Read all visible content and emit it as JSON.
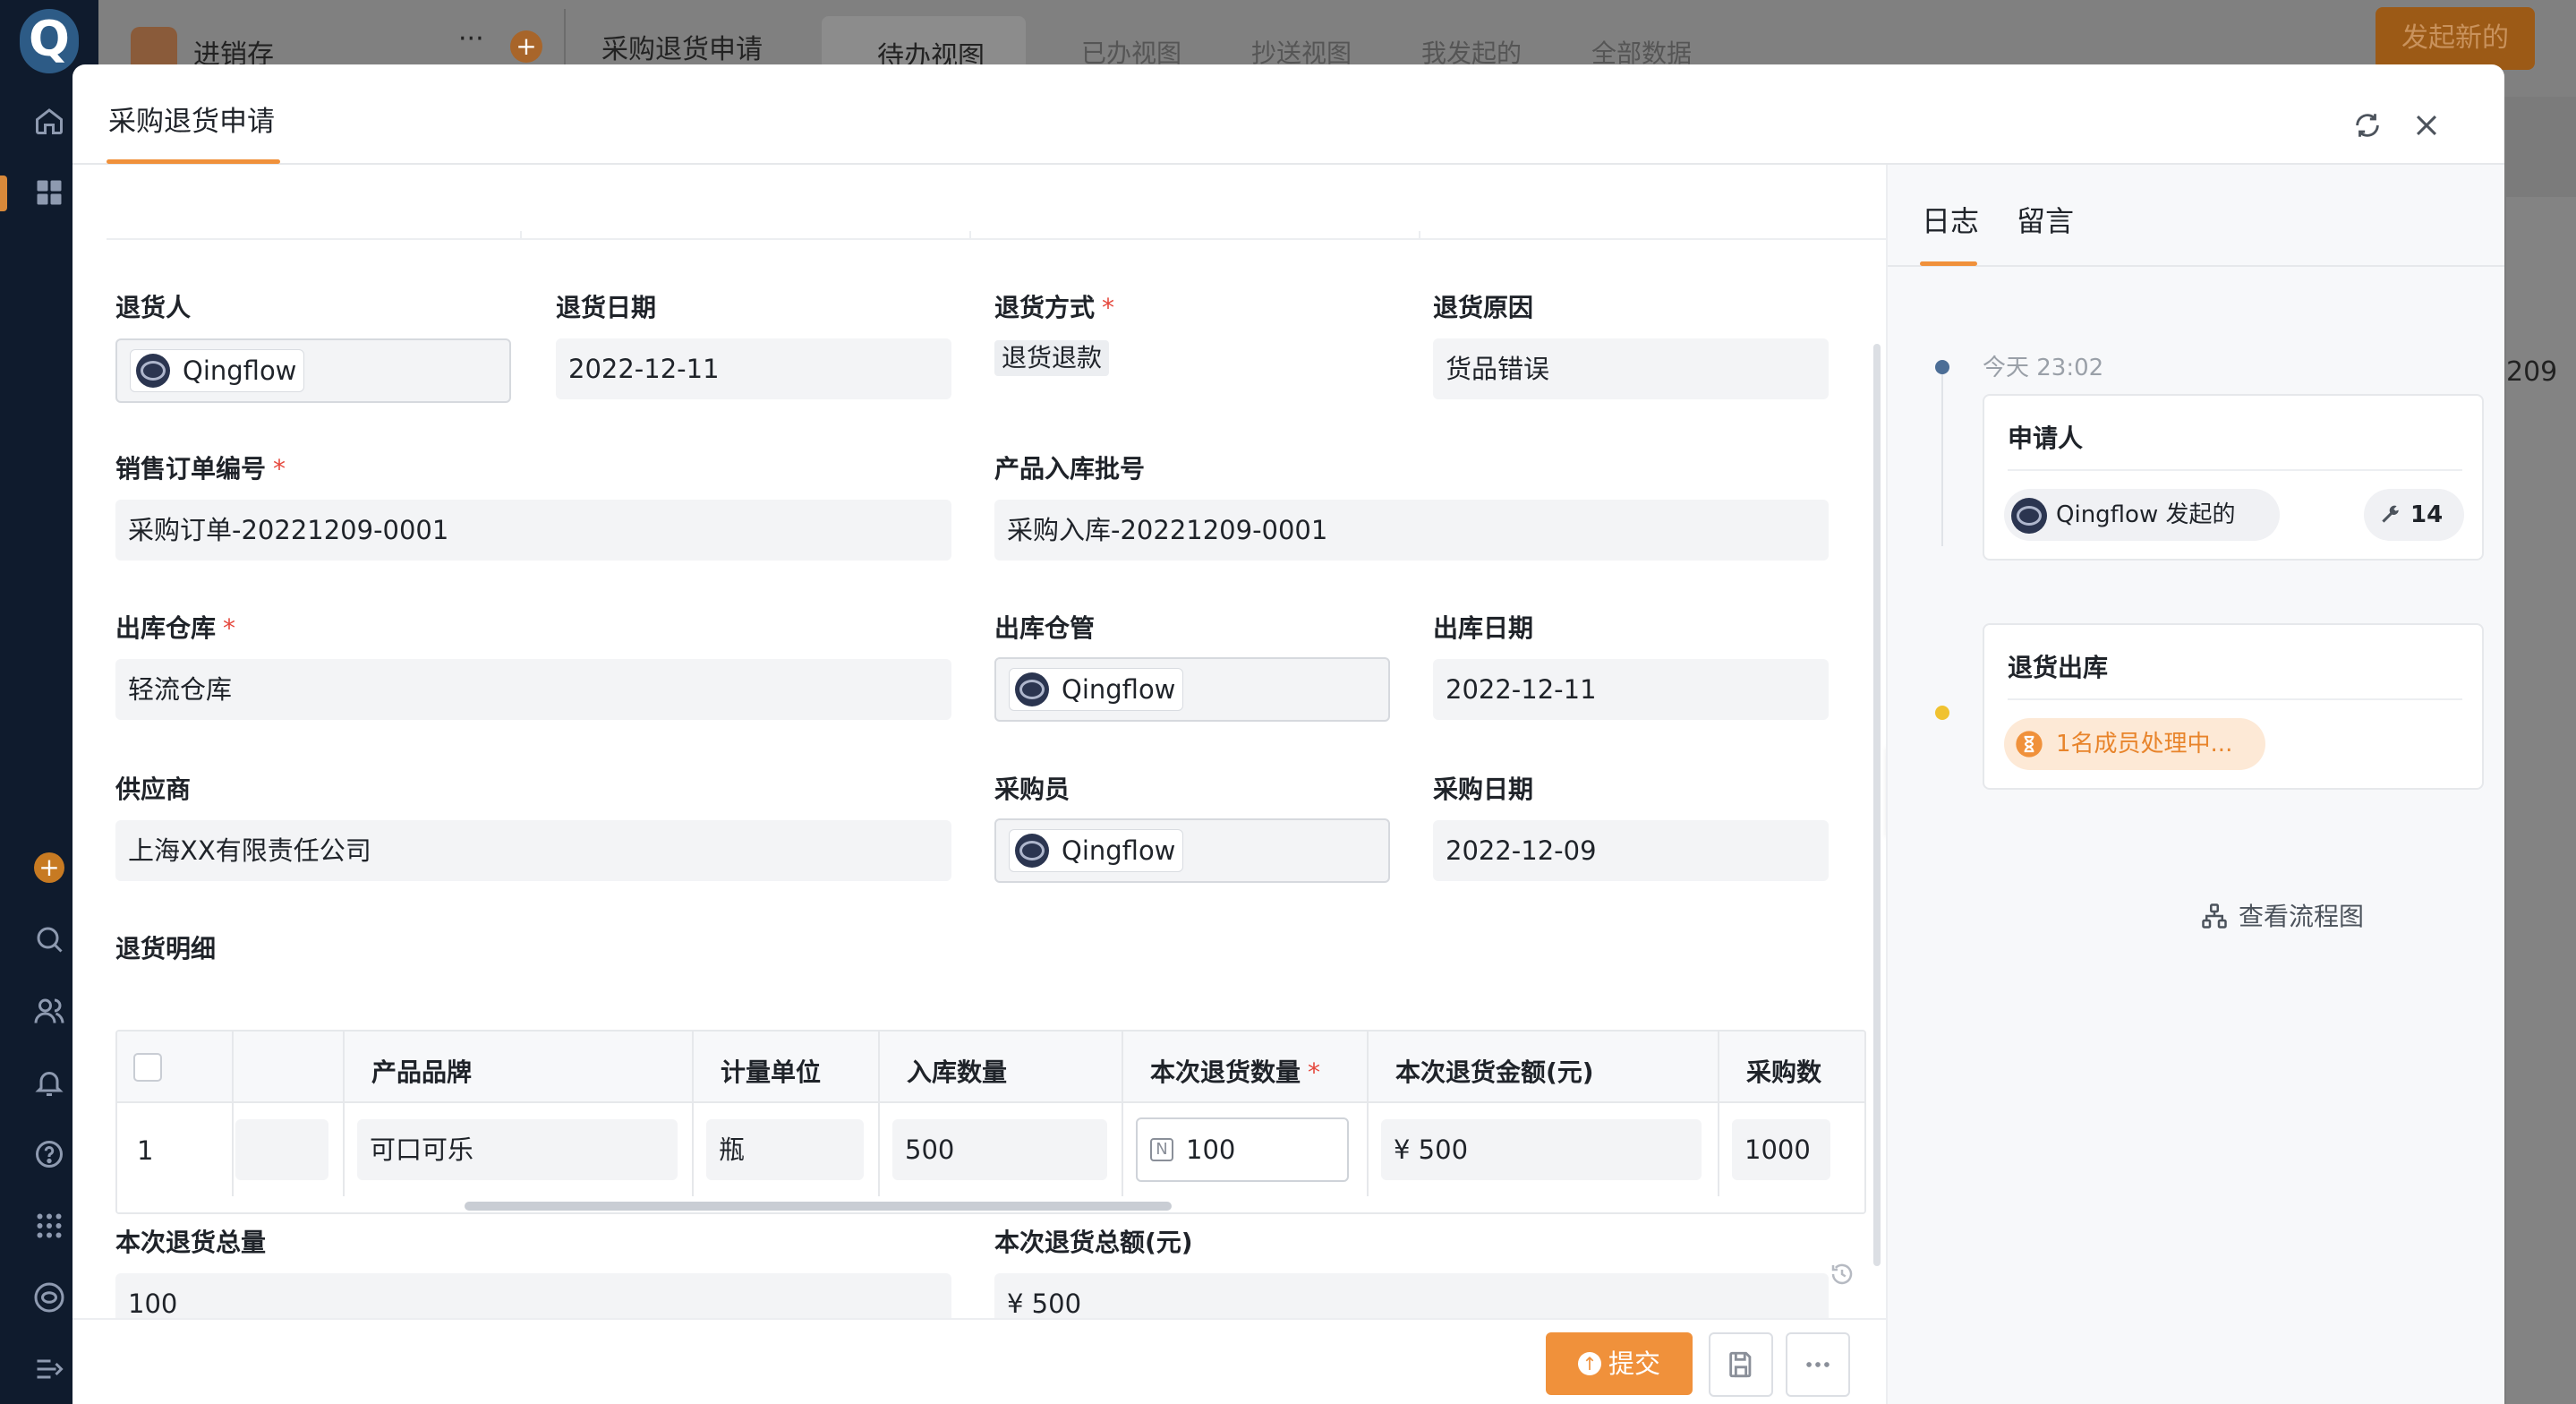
{
  "colors": {
    "accent": "#f0913b",
    "required": "#e5483d",
    "timeline_blue": "#4c6e96",
    "timeline_yellow": "#f0c230"
  },
  "background": {
    "app_name": "进销存",
    "view_title": "采购退货申请",
    "views": [
      "待办视图",
      "已办视图",
      "抄送视图",
      "我发起的",
      "全部数据"
    ],
    "start_button": "发起新的",
    "right_fragment": "209"
  },
  "modal": {
    "title": "采购退货申请"
  },
  "form": {
    "returner": {
      "label": "退货人",
      "value": "Qingflow"
    },
    "return_date": {
      "label": "退货日期",
      "value": "2022-12-11"
    },
    "return_method": {
      "label": "退货方式",
      "value": "退货退款",
      "required": true
    },
    "return_reason": {
      "label": "退货原因",
      "value": "货品错误"
    },
    "sales_order_no": {
      "label": "销售订单编号",
      "value": "采购订单-20221209-0001",
      "required": true
    },
    "inbound_batch_no": {
      "label": "产品入库批号",
      "value": "采购入库-20221209-0001"
    },
    "outbound_warehouse": {
      "label": "出库仓库",
      "value": "轻流仓库",
      "required": true
    },
    "warehouse_keeper": {
      "label": "出库仓管",
      "value": "Qingflow"
    },
    "outbound_date": {
      "label": "出库日期",
      "value": "2022-12-11"
    },
    "supplier": {
      "label": "供应商",
      "value": "上海XX有限责任公司"
    },
    "buyer": {
      "label": "采购员",
      "value": "Qingflow"
    },
    "purchase_date": {
      "label": "采购日期",
      "value": "2022-12-09"
    },
    "detail_title": "退货明细",
    "total_qty": {
      "label": "本次退货总量",
      "value": "100"
    },
    "total_amount": {
      "label": "本次退货总额(元)",
      "value": "¥ 500"
    }
  },
  "subtable": {
    "headers": [
      "产品品牌",
      "计量单位",
      "入库数量",
      "本次退货数量",
      "本次退货金额(元)",
      "采购数"
    ],
    "rows": [
      {
        "index": "1",
        "brand": "可口可乐",
        "unit": "瓶",
        "inbound_qty": "500",
        "return_qty": "100",
        "return_amount": "¥ 500",
        "purchase_qty": "1000"
      }
    ]
  },
  "footer": {
    "submit_label": "提交"
  },
  "right_panel": {
    "tabs": [
      "日志",
      "留言"
    ],
    "timeline": {
      "time": "今天 23:02",
      "applicant_title": "申请人",
      "applicant_text": "Qingflow 发起的",
      "applicant_count": "14",
      "step_title": "退货出库",
      "step_status": "1名成员处理中..."
    },
    "flow_link": "查看流程图"
  }
}
